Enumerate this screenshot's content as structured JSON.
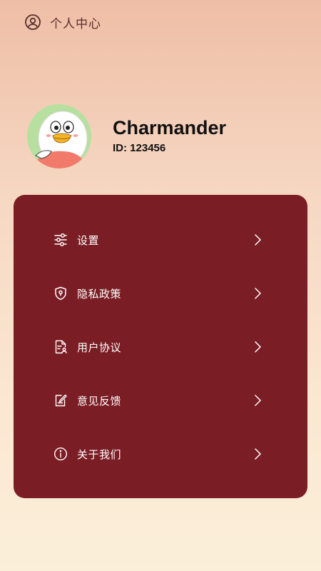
{
  "header": {
    "icon": "user-circle-icon",
    "title": "个人中心"
  },
  "profile": {
    "avatar": "duck-avatar",
    "username": "Charmander",
    "user_id": "ID: 123456"
  },
  "menu": {
    "items": [
      {
        "label": "设置",
        "icon": "settings-sliders-icon"
      },
      {
        "label": "隐私政策",
        "icon": "shield-icon"
      },
      {
        "label": "用户协议",
        "icon": "agreement-document-icon"
      },
      {
        "label": "意见反馈",
        "icon": "feedback-edit-icon"
      },
      {
        "label": "关于我们",
        "icon": "info-icon"
      }
    ],
    "chevron_icon": "chevron-right-icon"
  },
  "colors": {
    "card": "#7a1d24",
    "background_top": "#efbea6",
    "background_bottom": "#fbefd9",
    "text_dark": "#111111",
    "menu_text": "#ffffff"
  }
}
